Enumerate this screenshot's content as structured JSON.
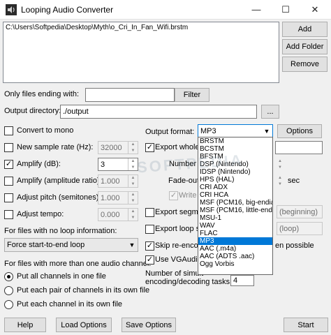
{
  "window": {
    "title": "Looping Audio Converter",
    "minimize_glyph": "—",
    "maximize_glyph": "☐",
    "close_glyph": "✕"
  },
  "file_list": {
    "items": [
      "C:\\Users\\Softpedia\\Desktop\\Myth\\o_Cri_In_Fan_Wifi.brstm"
    ]
  },
  "buttons": {
    "add": "Add",
    "add_folder": "Add Folder",
    "remove": "Remove",
    "filter": "Filter",
    "browse": "...",
    "options": "Options",
    "help": "Help",
    "load_options": "Load Options",
    "save_options": "Save Options",
    "start": "Start"
  },
  "filter": {
    "label": "Only files ending with:",
    "value": ""
  },
  "output_dir": {
    "label": "Output directory:",
    "value": "./output"
  },
  "left_options": {
    "convert_mono": {
      "label": "Convert to mono",
      "checked": false
    },
    "new_sample_rate": {
      "label": "New sample rate (Hz):",
      "checked": false,
      "value": "32000"
    },
    "amplify_db": {
      "label": "Amplify (dB):",
      "checked": true,
      "value": "3"
    },
    "amplify_ratio": {
      "label": "Amplify (amplitude ratio):",
      "checked": false,
      "value": "1.000"
    },
    "adjust_pitch": {
      "label": "Adjust pitch (semitones):",
      "checked": false,
      "value": "1.000"
    },
    "adjust_tempo": {
      "label": "Adjust tempo:",
      "checked": false,
      "value": "0.000"
    }
  },
  "no_loop": {
    "label": "For files with no loop information:",
    "value": "Force start-to-end loop"
  },
  "channels": {
    "label": "For files with more than one audio channel:",
    "options": [
      {
        "label": "Put all channels in one file",
        "selected": true
      },
      {
        "label": "Put each pair of channels in its own file",
        "selected": false
      },
      {
        "label": "Put each channel in its own file",
        "selected": false
      }
    ]
  },
  "output_format": {
    "label": "Output format:",
    "value": "MP3",
    "options": [
      "BRSTM",
      "BCSTM",
      "BFSTM",
      "DSP (Nintendo)",
      "IDSP (Nintendo)",
      "HPS (HAL)",
      "CRI ADX",
      "CRI HCA",
      "MSF (PCM16, big-endian)",
      "MSF (PCM16, little-endian)",
      "MSU-1",
      "WAV",
      "FLAC",
      "MP3",
      "AAC (.m4a)",
      "AAC (ADTS .aac)",
      "Ogg Vorbis"
    ],
    "selected_index": 13
  },
  "right_options": {
    "export_whole": "Export whole",
    "number_of": "Number o",
    "fade_out": "Fade-out",
    "sec": "sec",
    "write": "Write",
    "export_segments": "Export segme",
    "export_loop": "Export loop se",
    "skip_reencode": "Skip re-encod",
    "skip_reencode_tail": "en possible",
    "use_vgaudio": "Use VGAudio",
    "simultaneous_1": "Number of simult",
    "simultaneous_2": "encoding/decoding tasks:",
    "simultaneous_value": "4",
    "beginning": "(beginning)",
    "loop": "(loop)"
  },
  "watermark": "SOFTPEDIA"
}
